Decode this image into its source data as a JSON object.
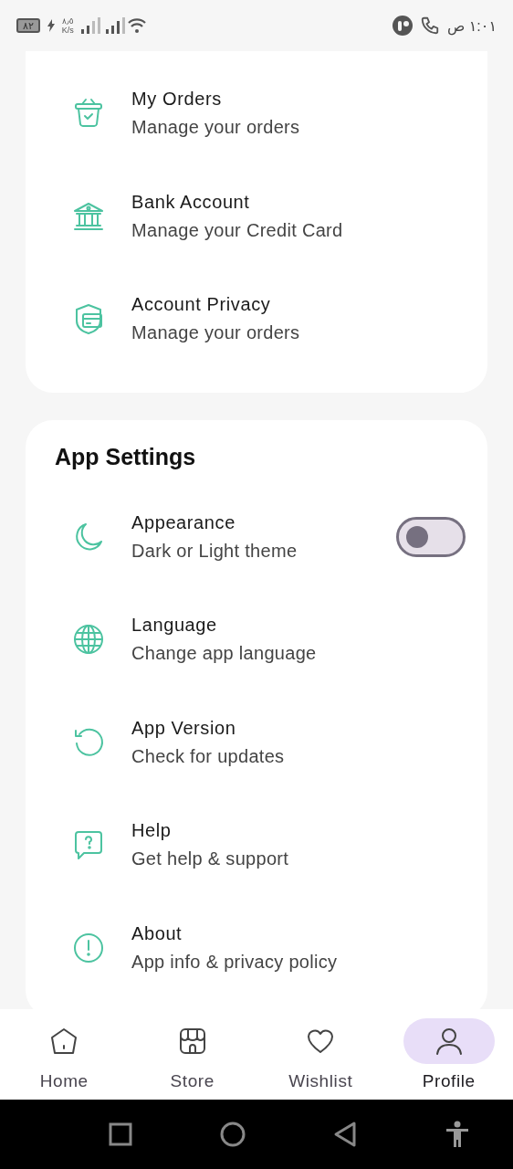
{
  "status_bar": {
    "battery": "٨٢",
    "speed_value": "٨٫٥",
    "speed_unit": "K/s",
    "time": "١:٠١ ص"
  },
  "sections": [
    {
      "rows": [
        {
          "kind": "basket",
          "title": "My Orders",
          "subtitle": "Manage your orders"
        },
        {
          "kind": "bank",
          "title": "Bank Account",
          "subtitle": "Manage your Credit Card"
        },
        {
          "kind": "shield",
          "title": "Account Privacy",
          "subtitle": "Manage your orders"
        }
      ]
    },
    {
      "title": "App Settings",
      "rows": [
        {
          "kind": "moon",
          "title": "Appearance",
          "subtitle": "Dark or Light theme",
          "toggle": {
            "on": false
          }
        },
        {
          "kind": "globe",
          "title": "Language",
          "subtitle": "Change app language"
        },
        {
          "kind": "refresh",
          "title": "App Version",
          "subtitle": "Check for updates"
        },
        {
          "kind": "help",
          "title": "Help",
          "subtitle": "Get help & support"
        },
        {
          "kind": "info",
          "title": "About",
          "subtitle": "App info & privacy policy"
        }
      ]
    }
  ],
  "bottom_nav": [
    {
      "kind": "home",
      "label": "Home",
      "selected": false
    },
    {
      "kind": "store",
      "label": "Store",
      "selected": false
    },
    {
      "kind": "heart",
      "label": "Wishlist",
      "selected": false
    },
    {
      "kind": "user",
      "label": "Profile",
      "selected": true
    }
  ]
}
